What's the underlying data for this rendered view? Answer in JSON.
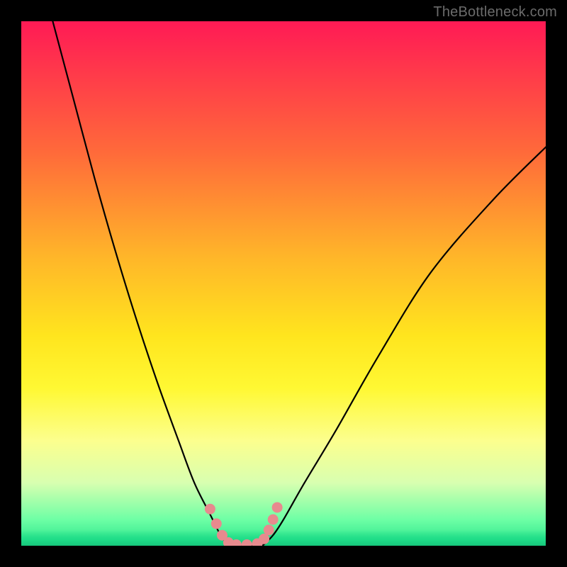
{
  "watermark": "TheBottleneck.com",
  "chart_data": {
    "type": "line",
    "title": "",
    "xlabel": "",
    "ylabel": "",
    "xlim": [
      0,
      100
    ],
    "ylim": [
      0,
      100
    ],
    "grid": false,
    "legend": false,
    "annotations": [],
    "series": [
      {
        "name": "left-curve",
        "x": [
          6,
          10,
          14,
          18,
          22,
          26,
          30,
          33,
          36,
          38,
          39.5
        ],
        "y": [
          100,
          85,
          70,
          56,
          43,
          31,
          20,
          12,
          6,
          2,
          0
        ]
      },
      {
        "name": "right-curve",
        "x": [
          46,
          48,
          50,
          54,
          60,
          68,
          78,
          90,
          100
        ],
        "y": [
          0,
          2,
          5,
          12,
          22,
          36,
          52,
          66,
          76
        ]
      },
      {
        "name": "valley-floor",
        "x": [
          39.5,
          46
        ],
        "y": [
          0,
          0
        ]
      }
    ],
    "markers": {
      "name": "pink-markers",
      "color": "#e78a8e",
      "points": [
        {
          "x": 36.0,
          "y": 7.0
        },
        {
          "x": 37.2,
          "y": 4.2
        },
        {
          "x": 38.3,
          "y": 2.0
        },
        {
          "x": 39.5,
          "y": 0.6
        },
        {
          "x": 41.0,
          "y": 0.2
        },
        {
          "x": 43.0,
          "y": 0.2
        },
        {
          "x": 45.0,
          "y": 0.4
        },
        {
          "x": 46.3,
          "y": 1.3
        },
        {
          "x": 47.2,
          "y": 3.0
        },
        {
          "x": 48.0,
          "y": 5.0
        },
        {
          "x": 48.8,
          "y": 7.3
        }
      ]
    },
    "background": {
      "type": "vertical-gradient",
      "stops": [
        {
          "pos": 0,
          "color": "#ff1a55"
        },
        {
          "pos": 45,
          "color": "#ffb629"
        },
        {
          "pos": 70,
          "color": "#fff833"
        },
        {
          "pos": 95,
          "color": "#6effa5"
        },
        {
          "pos": 100,
          "color": "#24e38a"
        }
      ]
    }
  }
}
